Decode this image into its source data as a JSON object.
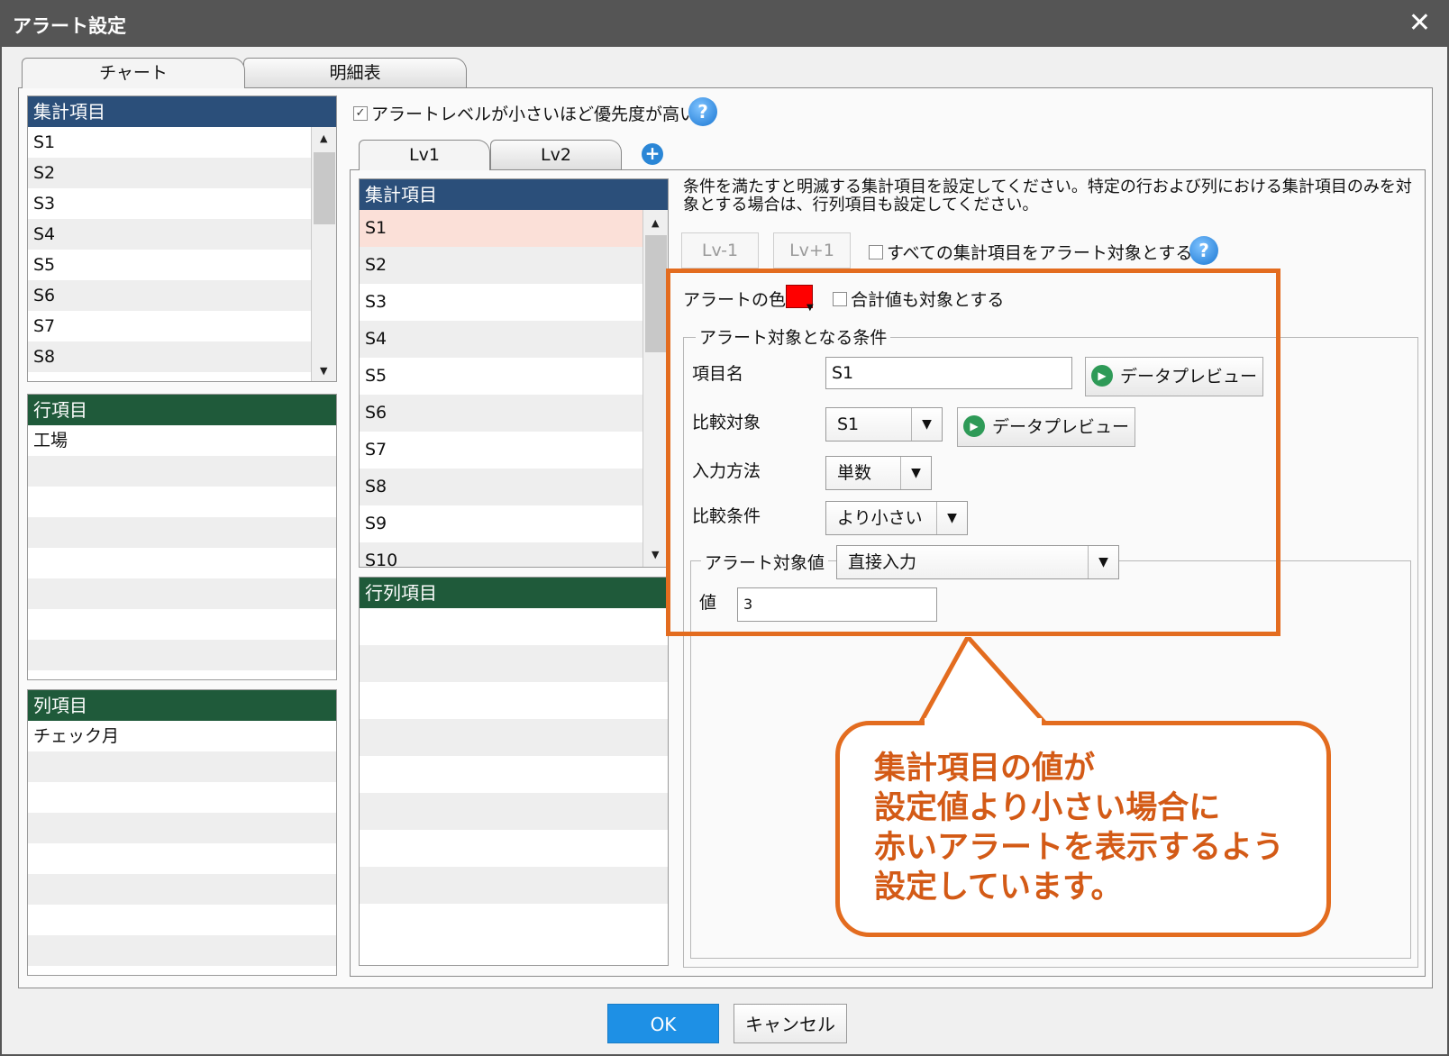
{
  "window": {
    "title": "アラート設定",
    "close_symbol": "✕"
  },
  "main_tabs": [
    {
      "label": "チャート"
    },
    {
      "label": "明細表"
    }
  ],
  "left": {
    "summary_header": "集計項目",
    "summary_items": [
      "S1",
      "S2",
      "S3",
      "S4",
      "S5",
      "S6",
      "S7",
      "S8"
    ],
    "row_header": "行項目",
    "row_items": [
      "工場"
    ],
    "column_header": "列項目",
    "column_items": [
      "チェック月"
    ]
  },
  "priority_checkbox": {
    "label": "アラートレベルが小さいほど優先度が高い",
    "checked": true
  },
  "help_symbol": "?",
  "level_tabs": [
    {
      "label": "Lv1"
    },
    {
      "label": "Lv2"
    }
  ],
  "add_level_symbol": "+",
  "middle": {
    "summary_header": "集計項目",
    "summary_items": [
      "S1",
      "S2",
      "S3",
      "S4",
      "S5",
      "S6",
      "S7",
      "S8",
      "S9",
      "S10"
    ],
    "rowcol_header": "行列項目"
  },
  "right": {
    "instructions_line1": "条件を満たすと明滅する集計項目を設定してください。特定の行および列における集計項目のみを対",
    "instructions_line2": "象とする場合は、行列項目も設定してください。",
    "lv_minus_label": "Lv-1",
    "lv_plus_label": "Lv+1",
    "all_items_checkbox": "すべての集計項目をアラート対象とする",
    "alert_color_label": "アラートの色",
    "alert_color": "#ff0000",
    "include_total_checkbox": "合計値も対象とする",
    "conditions_legend": "アラート対象となる条件",
    "item_name_label": "項目名",
    "item_name_value": "S1",
    "preview_label": "データプレビュー",
    "compare_target_label": "比較対象",
    "compare_target_value": "S1",
    "input_method_label": "入力方法",
    "input_method_value": "単数",
    "compare_condition_label": "比較条件",
    "compare_condition_value": "より小さい",
    "alert_value_legend": "アラート対象値",
    "alert_value_source": "直接入力",
    "value_label": "値",
    "value_input": "3"
  },
  "callout": {
    "lines": [
      "集計項目の値が",
      "設定値より小さい場合に",
      "赤いアラートを表示するよう",
      "設定しています。"
    ],
    "color": "#e36c1f"
  },
  "footer": {
    "ok_label": "OK",
    "cancel_label": "キャンセル"
  }
}
